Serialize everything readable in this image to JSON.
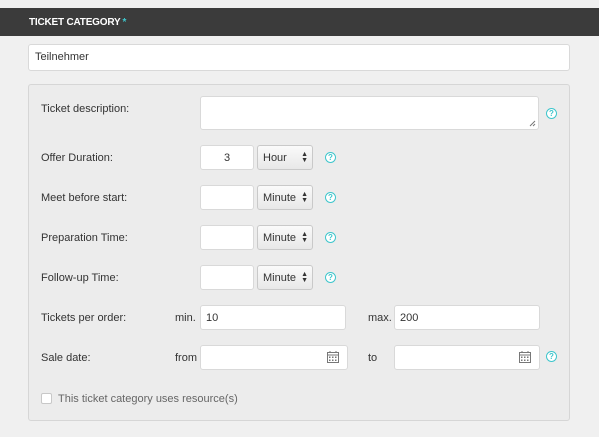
{
  "header": {
    "title": "TICKET CATEGORY",
    "required_mark": "*"
  },
  "category_name": {
    "value": "Teilnehmer"
  },
  "form": {
    "description": {
      "label": "Ticket description:",
      "value": ""
    },
    "offer_duration": {
      "label": "Offer Duration:",
      "value": "3",
      "unit": "Hour"
    },
    "meet_before": {
      "label": "Meet before start:",
      "value": "",
      "unit": "Minute"
    },
    "preparation": {
      "label": "Preparation Time:",
      "value": "",
      "unit": "Minute"
    },
    "follow_up": {
      "label": "Follow-up Time:",
      "value": "",
      "unit": "Minute"
    },
    "tickets_per_order": {
      "label": "Tickets per order:",
      "min_label": "min.",
      "min_value": "10",
      "max_label": "max.",
      "max_value": "200"
    },
    "sale_date": {
      "label": "Sale date:",
      "from_label": "from",
      "from_value": "",
      "to_label": "to",
      "to_value": ""
    },
    "uses_resources": {
      "label": "This ticket category uses resource(s)",
      "checked": false
    }
  },
  "help_glyph": "?",
  "colors": {
    "header_bg": "#3b3b3b",
    "accent": "#3ec6cc",
    "panel_bg": "#ececec"
  }
}
